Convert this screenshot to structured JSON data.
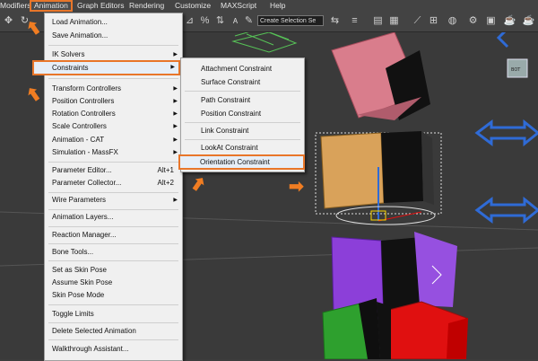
{
  "menubar": {
    "items": [
      "Modifiers",
      "Animation",
      "Graph Editors",
      "Rendering",
      "Customize",
      "MAXScript",
      "Help"
    ]
  },
  "toolbar": {
    "selection_set_placeholder": "Create Selection Se"
  },
  "animation_menu": {
    "items": [
      {
        "label": "Load Animation...",
        "shortcut": "",
        "submenu": false
      },
      {
        "label": "Save Animation...",
        "shortcut": "",
        "submenu": false
      },
      {
        "label": "IK Solvers",
        "shortcut": "",
        "submenu": true
      },
      {
        "label": "Constraints",
        "shortcut": "",
        "submenu": true
      },
      {
        "label": "Transform Controllers",
        "shortcut": "",
        "submenu": true
      },
      {
        "label": "Position Controllers",
        "shortcut": "",
        "submenu": true
      },
      {
        "label": "Rotation Controllers",
        "shortcut": "",
        "submenu": true
      },
      {
        "label": "Scale Controllers",
        "shortcut": "",
        "submenu": true
      },
      {
        "label": "Animation - CAT",
        "shortcut": "",
        "submenu": true
      },
      {
        "label": "Simulation - MassFX",
        "shortcut": "",
        "submenu": true
      },
      {
        "label": "Parameter Editor...",
        "shortcut": "Alt+1",
        "submenu": false
      },
      {
        "label": "Parameter Collector...",
        "shortcut": "Alt+2",
        "submenu": false
      },
      {
        "label": "Wire Parameters",
        "shortcut": "",
        "submenu": true
      },
      {
        "label": "Animation Layers...",
        "shortcut": "",
        "submenu": false
      },
      {
        "label": "Reaction Manager...",
        "shortcut": "",
        "submenu": false
      },
      {
        "label": "Bone Tools...",
        "shortcut": "",
        "submenu": false
      },
      {
        "label": "Set as Skin Pose",
        "shortcut": "",
        "submenu": false
      },
      {
        "label": "Assume Skin Pose",
        "shortcut": "",
        "submenu": false
      },
      {
        "label": "Skin Pose Mode",
        "shortcut": "",
        "submenu": false
      },
      {
        "label": "Toggle Limits",
        "shortcut": "",
        "submenu": false
      },
      {
        "label": "Delete Selected Animation",
        "shortcut": "",
        "submenu": false
      },
      {
        "label": "Walkthrough Assistant...",
        "shortcut": "",
        "submenu": false
      }
    ]
  },
  "constraints_submenu": {
    "items": [
      "Attachment Constraint",
      "Surface Constraint",
      "Path Constraint",
      "Position Constraint",
      "Link Constraint",
      "LookAt Constraint",
      "Orientation Constraint"
    ]
  },
  "colors": {
    "highlight_outline": "#e8762a",
    "cube_pink": "#d97d8c",
    "cube_orange": "#d9a25a",
    "cube_purple": "#8c3fd9",
    "cube_green": "#2ea02e",
    "cube_red": "#e01010",
    "arrow_blue": "#2f6bd6"
  }
}
